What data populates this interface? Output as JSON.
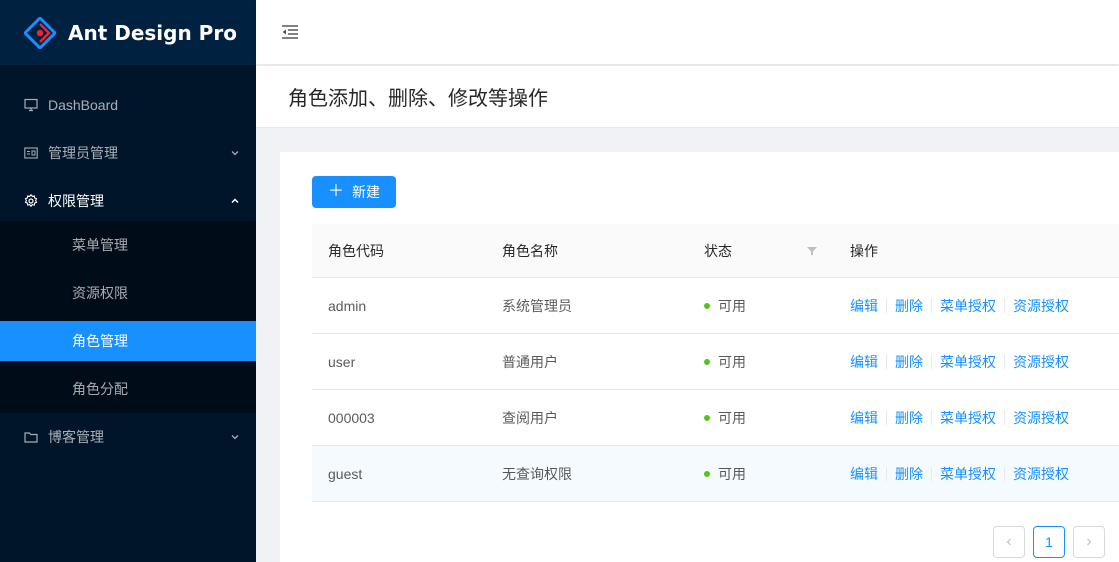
{
  "app": {
    "title": "Ant Design Pro"
  },
  "sidebar": {
    "items": [
      {
        "label": "DashBoard",
        "icon": "desktop-icon"
      },
      {
        "label": "管理员管理",
        "icon": "idcard-icon",
        "arrow": "down"
      },
      {
        "label": "权限管理",
        "icon": "setting-icon",
        "arrow": "up",
        "open": true,
        "children": [
          {
            "label": "菜单管理"
          },
          {
            "label": "资源权限"
          },
          {
            "label": "角色管理",
            "active": true
          },
          {
            "label": "角色分配"
          }
        ]
      },
      {
        "label": "博客管理",
        "icon": "folder-icon",
        "arrow": "down"
      }
    ]
  },
  "page": {
    "title": "角色添加、删除、修改等操作"
  },
  "toolbar": {
    "new_label": "新建"
  },
  "table": {
    "headers": [
      "角色代码",
      "角色名称",
      "状态",
      "操作"
    ],
    "rows": [
      {
        "code": "admin",
        "name": "系统管理员",
        "status": "可用"
      },
      {
        "code": "user",
        "name": "普通用户",
        "status": "可用"
      },
      {
        "code": "000003",
        "name": "查阅用户",
        "status": "可用"
      },
      {
        "code": "guest",
        "name": "无查询权限",
        "status": "可用"
      }
    ],
    "actions": [
      "编辑",
      "删除",
      "菜单授权",
      "资源授权"
    ]
  },
  "pagination": {
    "current": "1"
  },
  "colors": {
    "primary": "#1890ff",
    "sider": "#001529",
    "success": "#52c41a"
  }
}
